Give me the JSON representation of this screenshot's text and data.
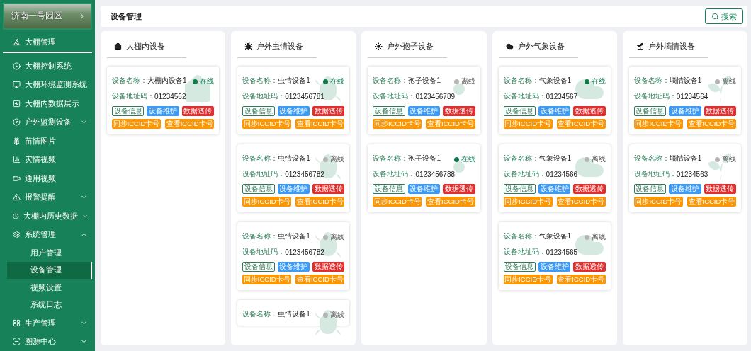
{
  "park": {
    "name": "济南一号园区"
  },
  "nav_top": {
    "label": "大棚管理"
  },
  "nav": [
    {
      "label": "大棚控制系统"
    },
    {
      "label": "大棚环境监测系统"
    },
    {
      "label": "大棚内数据展示"
    },
    {
      "label": "户外监测设备",
      "expanded": false
    },
    {
      "label": "苗情图片"
    },
    {
      "label": "灾情视频"
    },
    {
      "label": "通用视频"
    },
    {
      "label": "报警提醒",
      "expanded": false
    },
    {
      "label": "大棚内历史数据",
      "expanded": false
    },
    {
      "label": "系统管理",
      "expanded": true,
      "children": [
        {
          "label": "用户管理",
          "selected": false
        },
        {
          "label": "设备管理",
          "selected": true
        },
        {
          "label": "视频设置",
          "selected": false
        },
        {
          "label": "系统日志",
          "selected": false
        }
      ]
    },
    {
      "label": "生产管理",
      "expanded": false
    },
    {
      "label": "溯源中心",
      "expanded": false
    }
  ],
  "header": {
    "title": "设备管理",
    "search_button": "搜索"
  },
  "columns": [
    {
      "kind": "greenhouse",
      "title": "大棚内设备",
      "devices": [
        {
          "name_label": "设备名称：",
          "name": "大棚内设备1",
          "address_label": "设备地址码：",
          "address": "01234562",
          "online": true,
          "status": "在线",
          "buttons": [
            {
              "kind": "outline",
              "label": "设备信息"
            },
            {
              "kind": "blue",
              "label": "设备维护"
            },
            {
              "kind": "red",
              "label": "数据透传"
            },
            {
              "kind": "orange",
              "label": "同步ICCID卡号"
            },
            {
              "kind": "orange",
              "label": "查看ICCID卡号"
            }
          ]
        }
      ]
    },
    {
      "kind": "insect",
      "title": "户外虫情设备",
      "devices": [
        {
          "name_label": "设备名称：",
          "name": "虫情设备1",
          "address_label": "设备地址码：",
          "address": "0123456781",
          "online": true,
          "status": "在线",
          "buttons": [
            {
              "kind": "outline",
              "label": "设备信息"
            },
            {
              "kind": "blue",
              "label": "设备维护"
            },
            {
              "kind": "red",
              "label": "数据透传"
            },
            {
              "kind": "orange",
              "label": "同步ICCID卡号"
            },
            {
              "kind": "orange",
              "label": "查看ICCID卡号"
            }
          ]
        },
        {
          "name_label": "设备名称：",
          "name": "虫情设备1",
          "address_label": "设备地址码：",
          "address": "0123456782",
          "online": false,
          "status": "离线",
          "buttons": [
            {
              "kind": "outline",
              "label": "设备信息"
            },
            {
              "kind": "blue",
              "label": "设备维护"
            },
            {
              "kind": "red",
              "label": "数据透传"
            },
            {
              "kind": "orange",
              "label": "同步ICCID卡号"
            },
            {
              "kind": "orange",
              "label": "查看ICCID卡号"
            }
          ]
        },
        {
          "name_label": "设备名称：",
          "name": "虫情设备1",
          "address_label": "设备地址码：",
          "address": "0123456782",
          "online": false,
          "status": "离线",
          "buttons": [
            {
              "kind": "outline",
              "label": "设备信息"
            },
            {
              "kind": "blue",
              "label": "设备维护"
            },
            {
              "kind": "red",
              "label": "数据透传"
            },
            {
              "kind": "orange",
              "label": "同步ICCID卡号"
            },
            {
              "kind": "orange",
              "label": "查看ICCID卡号"
            }
          ]
        },
        {
          "name_label": "设备名称：",
          "name": "虫情设备1",
          "online": false,
          "status": "离线"
        }
      ]
    },
    {
      "kind": "spore",
      "title": "户外孢子设备",
      "devices": [
        {
          "name_label": "设备名称：",
          "name": "孢子设备1",
          "address_label": "设备地址码：",
          "address": "0123456789",
          "online": false,
          "status": "离线",
          "buttons": [
            {
              "kind": "outline",
              "label": "设备信息"
            },
            {
              "kind": "blue",
              "label": "设备维护"
            },
            {
              "kind": "red",
              "label": "数据透传"
            },
            {
              "kind": "orange",
              "label": "同步ICCID卡号"
            },
            {
              "kind": "orange",
              "label": "查看ICCID卡号"
            }
          ]
        },
        {
          "name_label": "设备名称：",
          "name": "孢子设备1",
          "address_label": "设备地址码：",
          "address": "0123456788",
          "online": true,
          "status": "在线",
          "buttons": [
            {
              "kind": "outline",
              "label": "设备信息"
            },
            {
              "kind": "blue",
              "label": "设备维护"
            },
            {
              "kind": "red",
              "label": "数据透传"
            },
            {
              "kind": "orange",
              "label": "同步ICCID卡号"
            },
            {
              "kind": "orange",
              "label": "查看ICCID卡号"
            }
          ]
        }
      ]
    },
    {
      "kind": "weather",
      "title": "户外气象设备",
      "devices": [
        {
          "name_label": "设备名称：",
          "name": "气象设备1",
          "address_label": "设备地址码：",
          "address": "01234567",
          "online": true,
          "status": "在线",
          "buttons": [
            {
              "kind": "outline",
              "label": "设备信息"
            },
            {
              "kind": "blue",
              "label": "设备维护"
            },
            {
              "kind": "red",
              "label": "数据透传"
            },
            {
              "kind": "orange",
              "label": "同步ICCID卡号"
            },
            {
              "kind": "orange",
              "label": "查看ICCID卡号"
            }
          ]
        },
        {
          "name_label": "设备名称：",
          "name": "气象设备1",
          "address_label": "设备地址码：",
          "address": "01234566",
          "online": false,
          "status": "离线",
          "buttons": [
            {
              "kind": "outline",
              "label": "设备信息"
            },
            {
              "kind": "blue",
              "label": "设备维护"
            },
            {
              "kind": "red",
              "label": "数据透传"
            },
            {
              "kind": "orange",
              "label": "同步ICCID卡号"
            },
            {
              "kind": "orange",
              "label": "查看ICCID卡号"
            }
          ]
        },
        {
          "name_label": "设备名称：",
          "name": "气象设备1",
          "address_label": "设备地址码：",
          "address": "01234565",
          "online": false,
          "status": "离线",
          "buttons": [
            {
              "kind": "outline",
              "label": "设备信息"
            },
            {
              "kind": "blue",
              "label": "设备维护"
            },
            {
              "kind": "red",
              "label": "数据透传"
            },
            {
              "kind": "orange",
              "label": "同步ICCID卡号"
            },
            {
              "kind": "orange",
              "label": "查看ICCID卡号"
            }
          ]
        }
      ]
    },
    {
      "kind": "soil",
      "title": "户外墒情设备",
      "devices": [
        {
          "name_label": "设备名称：",
          "name": "墒情设备1",
          "address_label": "设备地址码：",
          "address": "01234564",
          "online": false,
          "status": "离线",
          "buttons": [
            {
              "kind": "outline",
              "label": "设备信息"
            },
            {
              "kind": "blue",
              "label": "设备维护"
            },
            {
              "kind": "red",
              "label": "数据透传"
            },
            {
              "kind": "orange",
              "label": "同步ICCID卡号"
            },
            {
              "kind": "orange",
              "label": "查看ICCID卡号"
            }
          ]
        },
        {
          "name_label": "设备名称：",
          "name": "墒情设备1",
          "address_label": "设备地址码：",
          "address": "01234563",
          "online": false,
          "status": "离线",
          "buttons": [
            {
              "kind": "outline",
              "label": "设备信息"
            },
            {
              "kind": "blue",
              "label": "设备维护"
            },
            {
              "kind": "red",
              "label": "数据透传"
            },
            {
              "kind": "orange",
              "label": "同步ICCID卡号"
            },
            {
              "kind": "orange",
              "label": "查看ICCID卡号"
            }
          ]
        }
      ]
    }
  ]
}
